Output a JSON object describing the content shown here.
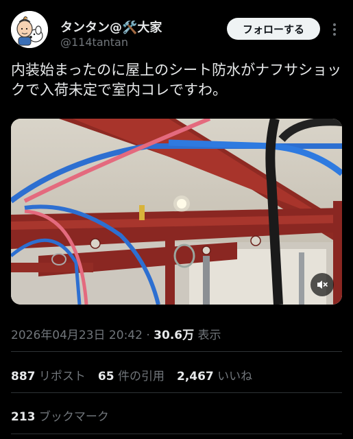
{
  "author": {
    "display_name": "タンタン@🛠️大家",
    "handle": "@114tantan",
    "avatar_icon": "cartoon-character-avatar"
  },
  "follow_label": "フォローする",
  "more_icon": "more-vertical-icon",
  "tweet_text": "内装始まったのに屋上のシート防水がナフサショックで入荷未定で室内コレですわ。",
  "media": {
    "type": "video",
    "mute_icon": "speaker-muted-icon"
  },
  "meta": {
    "timestamp": "2026年04月23日 20:42",
    "separator": " · ",
    "views_count": "30.6万",
    "views_label": " 表示"
  },
  "stats": {
    "reposts": {
      "count": "887",
      "label": "リポスト"
    },
    "quotes": {
      "count": "65",
      "label": "件の引用"
    },
    "likes": {
      "count": "2,467",
      "label": "いいね"
    },
    "bookmarks": {
      "count": "213",
      "label": "ブックマーク"
    }
  },
  "colors": {
    "background": "#000000",
    "text": "#e7e9ea",
    "secondary_text": "#71767b",
    "divider": "#2f3336",
    "follow_button_bg": "#eff3f4"
  }
}
